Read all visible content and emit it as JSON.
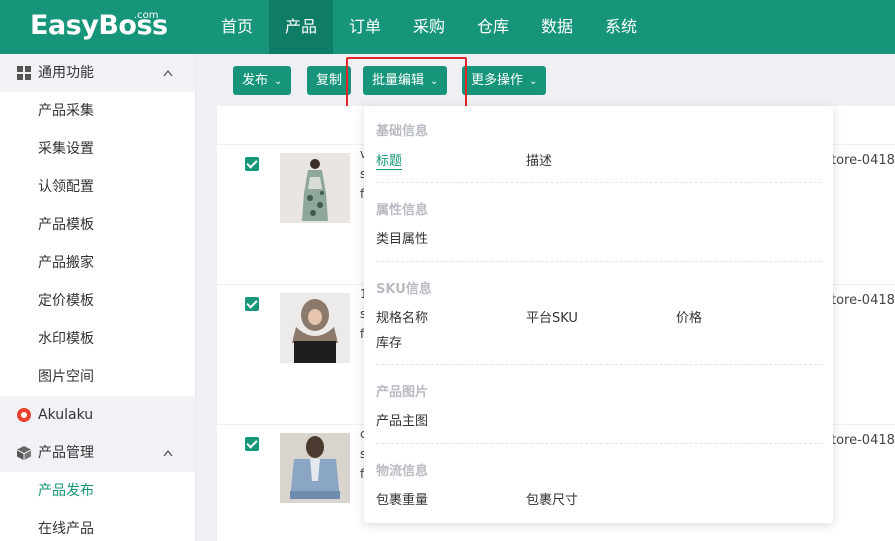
{
  "app": {
    "logo": "EasyBoss",
    "logo_suffix": ".com"
  },
  "nav": [
    {
      "label": "首页",
      "active": false
    },
    {
      "label": "产品",
      "active": true
    },
    {
      "label": "订单",
      "active": false
    },
    {
      "label": "采购",
      "active": false
    },
    {
      "label": "仓库",
      "active": false
    },
    {
      "label": "数据",
      "active": false
    },
    {
      "label": "系统",
      "active": false
    }
  ],
  "sidebar": {
    "group1": {
      "label": "通用功能",
      "chevron": "^"
    },
    "group1_items": [
      "产品采集",
      "采集设置",
      "认领配置",
      "产品模板",
      "产品搬家",
      "定价模板",
      "水印模板",
      "图片空间"
    ],
    "akulaku": "Akulaku",
    "group2": {
      "label": "产品管理",
      "chevron": "^"
    },
    "group2_items": [
      "产品发布",
      "在线产品"
    ]
  },
  "toolbar": {
    "publish": "发布",
    "copy": "复制",
    "batch_edit": "批量编辑",
    "more": "更多操作"
  },
  "rows": [
    {
      "store": "tore-0418",
      "frag": [
        "v",
        "s",
        "f"
      ]
    },
    {
      "store": "tore-0418",
      "frag": [
        "1",
        "s",
        "f"
      ]
    },
    {
      "store": "tore-0418",
      "frag": [
        "c",
        "s",
        "f"
      ]
    }
  ],
  "dropdown": {
    "basic": {
      "title": "基础信息",
      "items": [
        "标题",
        "描述"
      ]
    },
    "attr": {
      "title": "属性信息",
      "items": [
        "类目属性"
      ]
    },
    "sku": {
      "title": "SKU信息",
      "items": [
        "规格名称",
        "平台SKU",
        "价格",
        "库存"
      ]
    },
    "images": {
      "title": "产品图片",
      "items": [
        "产品主图"
      ]
    },
    "logistics": {
      "title": "物流信息",
      "items": [
        "包裹重量",
        "包裹尺寸"
      ]
    }
  },
  "colors": {
    "brand": "#16957a",
    "brand_dark": "#0f7d65",
    "highlight": "#e0262a"
  }
}
